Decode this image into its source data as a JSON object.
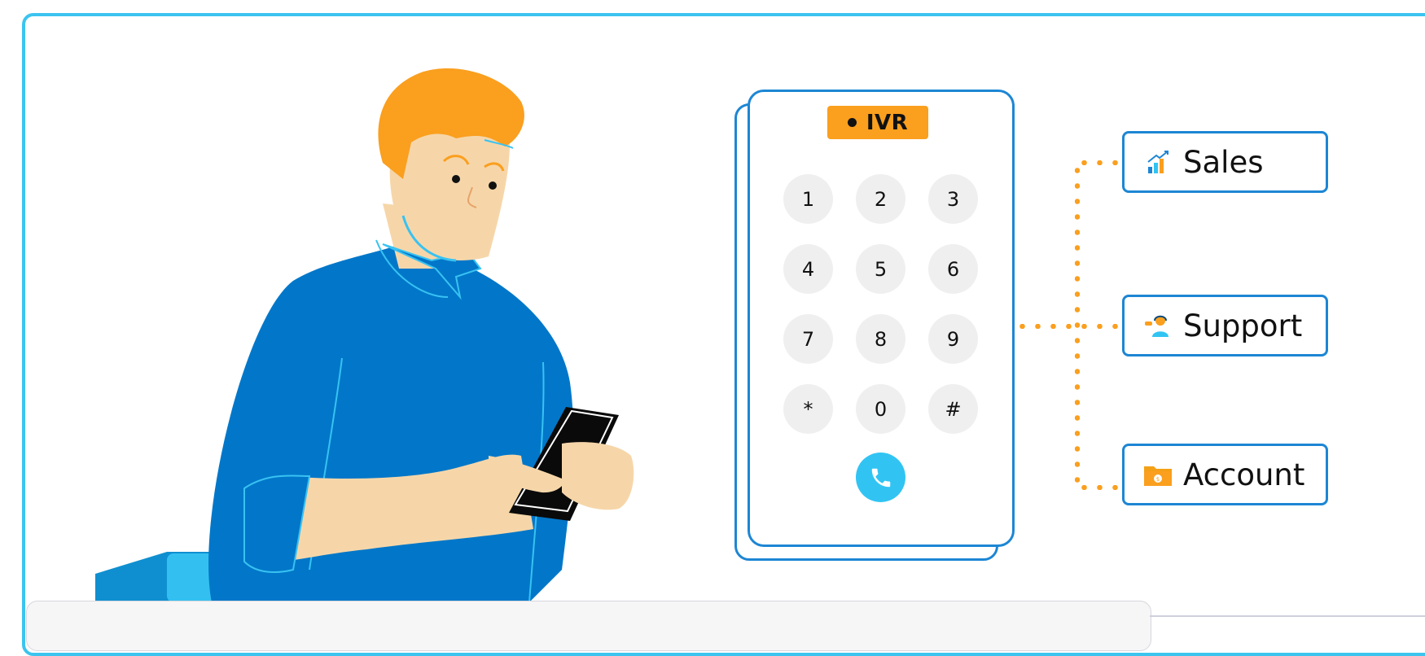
{
  "colors": {
    "frame": "#3cc4ef",
    "accent_blue": "#1d86d4",
    "orange": "#fa9f1e",
    "call_button": "#31c4f3",
    "key_bg": "#f0efef"
  },
  "ivr": {
    "badge_label": "IVR",
    "keys": [
      "1",
      "2",
      "3",
      "4",
      "5",
      "6",
      "7",
      "8",
      "9",
      "*",
      "0",
      "#"
    ],
    "call_icon": "phone-icon"
  },
  "destinations": [
    {
      "label": "Sales",
      "icon": "bar-chart-growth-icon"
    },
    {
      "label": "Support",
      "icon": "support-agent-icon"
    },
    {
      "label": "Account",
      "icon": "folder-money-icon"
    }
  ]
}
